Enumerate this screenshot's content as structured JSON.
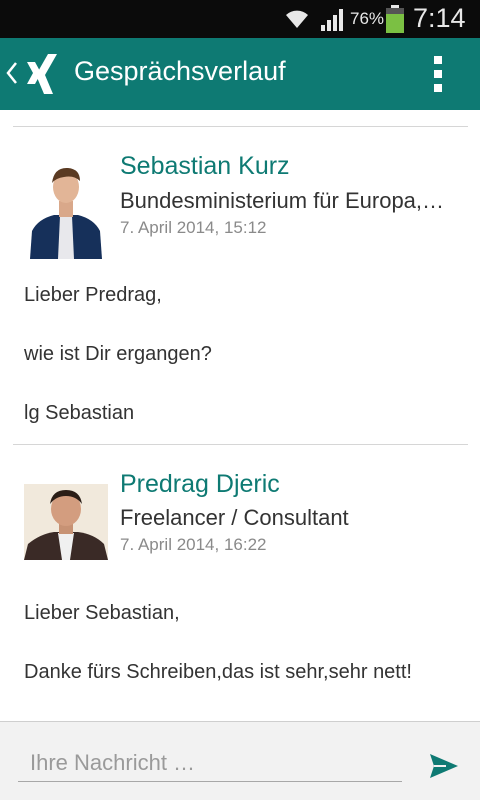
{
  "status_bar": {
    "battery_percent": "76%",
    "time": "7:14"
  },
  "header": {
    "title": "Gesprächsverlauf",
    "icons": [
      "back-chevron-icon",
      "xing-logo-icon",
      "overflow-menu-icon"
    ]
  },
  "messages": [
    {
      "sender": "Sebastian Kurz",
      "organization": "Bundesministerium für Europa,…",
      "timestamp": "7. April 2014, 15:12",
      "paragraphs": [
        "Lieber Predrag,",
        "wie ist Dir ergangen?",
        "lg Sebastian"
      ]
    },
    {
      "sender": "Predrag Djeric",
      "organization": "Freelancer / Consultant",
      "timestamp": "7. April 2014, 16:22",
      "paragraphs": [
        "Lieber Sebastian,",
        "Danke fürs Schreiben,das ist sehr,sehr nett!"
      ]
    }
  ],
  "compose": {
    "placeholder": "Ihre Nachricht …",
    "value": ""
  },
  "colors": {
    "accent": "#0e7a73",
    "status_bar": "#0b0b0b"
  }
}
